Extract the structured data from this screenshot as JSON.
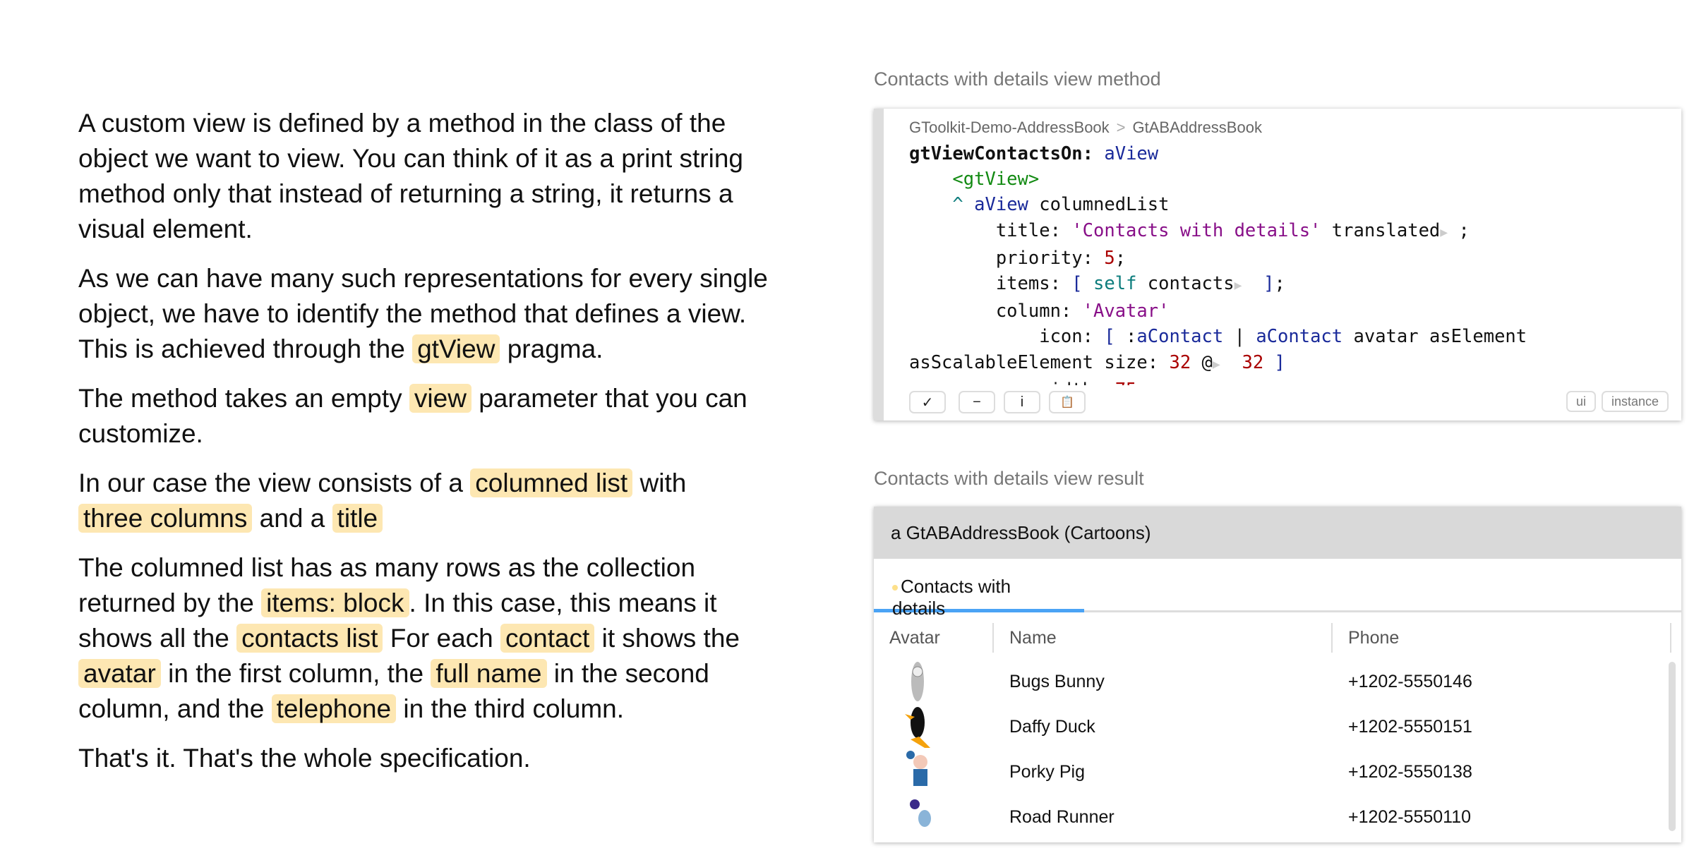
{
  "explanation": {
    "p1": "A custom view is defined by a method in the class of the object we want to view. You can think of it as a print string method only that instead of returning a string, it returns a visual element.",
    "p2a": "As we can have many such representations for every single object, we have to identify the method that defines a view. This is achieved through the ",
    "p2h": "gtView",
    "p2b": " pragma.",
    "p3a": "The method takes an empty ",
    "p3h": "view",
    "p3b": " parameter that you can customize.",
    "p4a": "In our case the view consists of a ",
    "p4h1": "columned list",
    "p4b": " with ",
    "p4h2": "three columns",
    "p4c": " and a ",
    "p4h3": "title",
    "p5a": "The columned list has as many rows as the collection returned by the ",
    "p5h1": "items: block",
    "p5b": ". In this case, this means it shows all the ",
    "p5h2": "contacts list",
    "p5c": " For each ",
    "p5h3": "contact",
    "p5d": " it shows the ",
    "p5h4": "avatar",
    "p5e": " in the first column, the ",
    "p5h5": "full name",
    "p5f": " in the second column, and the ",
    "p5h6": "telephone",
    "p5g": " in the third column.",
    "p6": "That's it. That's the whole specification."
  },
  "method_section": {
    "title": "Contacts with details view method",
    "package": "GToolkit-Demo-AddressBook",
    "separator": ">",
    "class": "GtABAddressBook",
    "buttons": {
      "accept": "✓",
      "remove": "−",
      "inspect": "i",
      "copy": "📋",
      "ui": "ui",
      "instance": "instance"
    }
  },
  "result_section": {
    "title": "Contacts with details view result",
    "header": "a GtABAddressBook (Cartoons)",
    "tab": "Contacts with details",
    "columns": [
      "Avatar",
      "Name",
      "Phone"
    ],
    "rows": [
      {
        "name": "Bugs Bunny",
        "phone": "+1202-5550146"
      },
      {
        "name": "Daffy Duck",
        "phone": "+1202-5550151"
      },
      {
        "name": "Porky Pig",
        "phone": "+1202-5550138"
      },
      {
        "name": "Road Runner",
        "phone": "+1202-5550110"
      }
    ]
  },
  "colors": {
    "highlight": "#fde7b2",
    "tab_accent": "#4aa3f5",
    "header_bg": "#d9d9d9"
  }
}
